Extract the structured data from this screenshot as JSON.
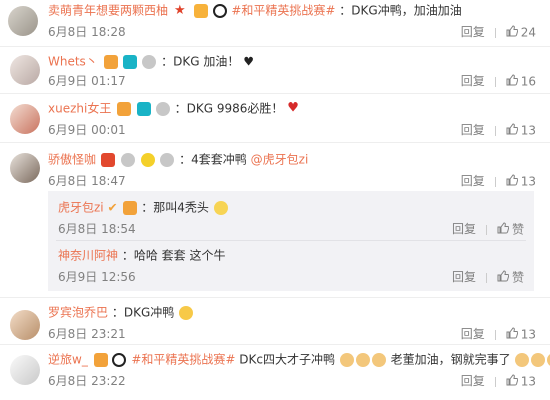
{
  "comments": [
    {
      "user": "卖萌青年想要两颗西柚",
      "text": "DKG冲鸭，加油加油",
      "topic": "#和平精英挑战赛#",
      "time": "6月8日 18:28",
      "reply": "回复",
      "likes": "24"
    },
    {
      "user": "Whets丶",
      "text": "DKG 加油！",
      "time": "6月9日 01:17",
      "reply": "回复",
      "likes": "16"
    },
    {
      "user": "xuezhi女王",
      "text": "DKG  9986必胜！",
      "time": "6月9日 00:01",
      "reply": "回复",
      "likes": "13"
    },
    {
      "user": "骄傲怪咖",
      "text": "4套套冲鸭",
      "mention": "@虎牙包zi",
      "time": "6月8日 18:47",
      "reply": "回复",
      "likes": "13",
      "sub_replies": [
        {
          "user": "虎牙包zi",
          "text": "那叫4秃头",
          "time": "6月8日 18:54",
          "reply": "回复",
          "like_label": "赞"
        },
        {
          "user": "神奈川阿神",
          "text": "哈哈  套套  这个牛",
          "time": "6月9日 12:56",
          "reply": "回复",
          "like_label": "赞"
        }
      ]
    },
    {
      "user": "罗宾泡乔巴",
      "text": "DKG冲鸭",
      "time": "6月8日 23:21",
      "reply": "回复",
      "likes": "13"
    },
    {
      "user": "逆旅w_",
      "topic": "#和平精英挑战赛#",
      "text": "DKc四大才子冲鸭",
      "text2": "老董加油，钢就完事了",
      "time": "6月8日 23:22",
      "reply": "回复",
      "likes": "13"
    }
  ],
  "colors": {
    "link": "#eb7350",
    "meta": "#808080",
    "subbox": "#f2f2f5"
  },
  "icons": [
    "thumb-up-icon",
    "vip-badge-icon",
    "emoji-icon",
    "heart-icon",
    "heart-dark-icon",
    "panda-icon"
  ]
}
